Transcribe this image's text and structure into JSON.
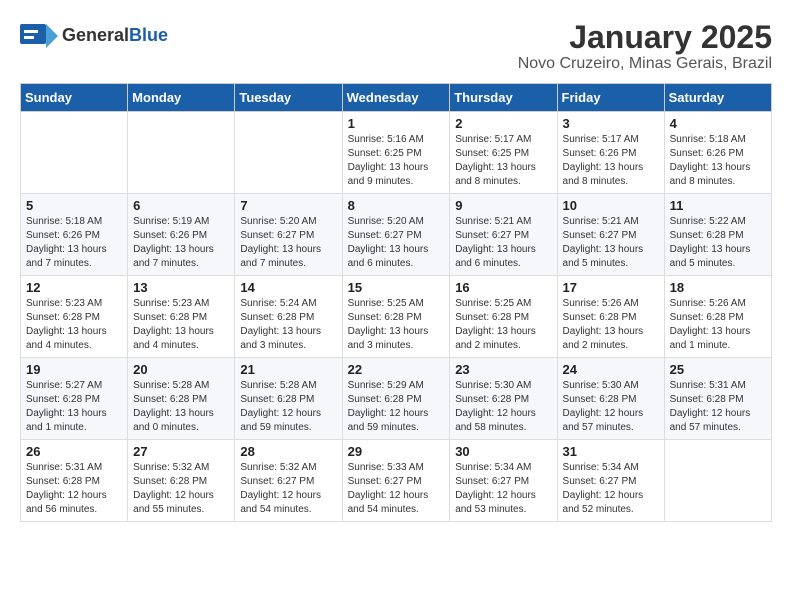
{
  "header": {
    "logo_general": "General",
    "logo_blue": "Blue",
    "title": "January 2025",
    "subtitle": "Novo Cruzeiro, Minas Gerais, Brazil"
  },
  "weekdays": [
    "Sunday",
    "Monday",
    "Tuesday",
    "Wednesday",
    "Thursday",
    "Friday",
    "Saturday"
  ],
  "weeks": [
    [
      {
        "day": "",
        "info": ""
      },
      {
        "day": "",
        "info": ""
      },
      {
        "day": "",
        "info": ""
      },
      {
        "day": "1",
        "info": "Sunrise: 5:16 AM\nSunset: 6:25 PM\nDaylight: 13 hours and 9 minutes."
      },
      {
        "day": "2",
        "info": "Sunrise: 5:17 AM\nSunset: 6:25 PM\nDaylight: 13 hours and 8 minutes."
      },
      {
        "day": "3",
        "info": "Sunrise: 5:17 AM\nSunset: 6:26 PM\nDaylight: 13 hours and 8 minutes."
      },
      {
        "day": "4",
        "info": "Sunrise: 5:18 AM\nSunset: 6:26 PM\nDaylight: 13 hours and 8 minutes."
      }
    ],
    [
      {
        "day": "5",
        "info": "Sunrise: 5:18 AM\nSunset: 6:26 PM\nDaylight: 13 hours and 7 minutes."
      },
      {
        "day": "6",
        "info": "Sunrise: 5:19 AM\nSunset: 6:26 PM\nDaylight: 13 hours and 7 minutes."
      },
      {
        "day": "7",
        "info": "Sunrise: 5:20 AM\nSunset: 6:27 PM\nDaylight: 13 hours and 7 minutes."
      },
      {
        "day": "8",
        "info": "Sunrise: 5:20 AM\nSunset: 6:27 PM\nDaylight: 13 hours and 6 minutes."
      },
      {
        "day": "9",
        "info": "Sunrise: 5:21 AM\nSunset: 6:27 PM\nDaylight: 13 hours and 6 minutes."
      },
      {
        "day": "10",
        "info": "Sunrise: 5:21 AM\nSunset: 6:27 PM\nDaylight: 13 hours and 5 minutes."
      },
      {
        "day": "11",
        "info": "Sunrise: 5:22 AM\nSunset: 6:28 PM\nDaylight: 13 hours and 5 minutes."
      }
    ],
    [
      {
        "day": "12",
        "info": "Sunrise: 5:23 AM\nSunset: 6:28 PM\nDaylight: 13 hours and 4 minutes."
      },
      {
        "day": "13",
        "info": "Sunrise: 5:23 AM\nSunset: 6:28 PM\nDaylight: 13 hours and 4 minutes."
      },
      {
        "day": "14",
        "info": "Sunrise: 5:24 AM\nSunset: 6:28 PM\nDaylight: 13 hours and 3 minutes."
      },
      {
        "day": "15",
        "info": "Sunrise: 5:25 AM\nSunset: 6:28 PM\nDaylight: 13 hours and 3 minutes."
      },
      {
        "day": "16",
        "info": "Sunrise: 5:25 AM\nSunset: 6:28 PM\nDaylight: 13 hours and 2 minutes."
      },
      {
        "day": "17",
        "info": "Sunrise: 5:26 AM\nSunset: 6:28 PM\nDaylight: 13 hours and 2 minutes."
      },
      {
        "day": "18",
        "info": "Sunrise: 5:26 AM\nSunset: 6:28 PM\nDaylight: 13 hours and 1 minute."
      }
    ],
    [
      {
        "day": "19",
        "info": "Sunrise: 5:27 AM\nSunset: 6:28 PM\nDaylight: 13 hours and 1 minute."
      },
      {
        "day": "20",
        "info": "Sunrise: 5:28 AM\nSunset: 6:28 PM\nDaylight: 13 hours and 0 minutes."
      },
      {
        "day": "21",
        "info": "Sunrise: 5:28 AM\nSunset: 6:28 PM\nDaylight: 12 hours and 59 minutes."
      },
      {
        "day": "22",
        "info": "Sunrise: 5:29 AM\nSunset: 6:28 PM\nDaylight: 12 hours and 59 minutes."
      },
      {
        "day": "23",
        "info": "Sunrise: 5:30 AM\nSunset: 6:28 PM\nDaylight: 12 hours and 58 minutes."
      },
      {
        "day": "24",
        "info": "Sunrise: 5:30 AM\nSunset: 6:28 PM\nDaylight: 12 hours and 57 minutes."
      },
      {
        "day": "25",
        "info": "Sunrise: 5:31 AM\nSunset: 6:28 PM\nDaylight: 12 hours and 57 minutes."
      }
    ],
    [
      {
        "day": "26",
        "info": "Sunrise: 5:31 AM\nSunset: 6:28 PM\nDaylight: 12 hours and 56 minutes."
      },
      {
        "day": "27",
        "info": "Sunrise: 5:32 AM\nSunset: 6:28 PM\nDaylight: 12 hours and 55 minutes."
      },
      {
        "day": "28",
        "info": "Sunrise: 5:32 AM\nSunset: 6:27 PM\nDaylight: 12 hours and 54 minutes."
      },
      {
        "day": "29",
        "info": "Sunrise: 5:33 AM\nSunset: 6:27 PM\nDaylight: 12 hours and 54 minutes."
      },
      {
        "day": "30",
        "info": "Sunrise: 5:34 AM\nSunset: 6:27 PM\nDaylight: 12 hours and 53 minutes."
      },
      {
        "day": "31",
        "info": "Sunrise: 5:34 AM\nSunset: 6:27 PM\nDaylight: 12 hours and 52 minutes."
      },
      {
        "day": "",
        "info": ""
      }
    ]
  ]
}
